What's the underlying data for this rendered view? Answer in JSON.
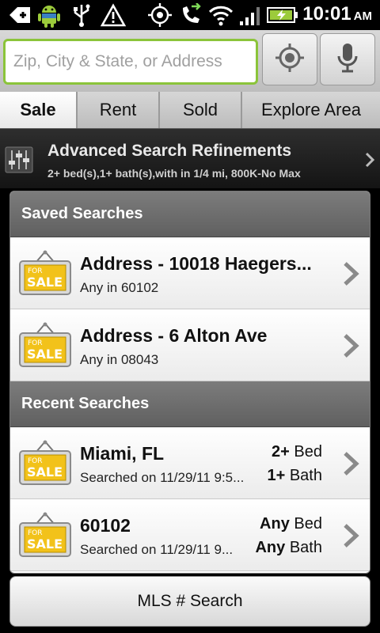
{
  "status_bar": {
    "time": "10:01",
    "ampm": "AM",
    "icons": [
      "back-plus-icon",
      "android-icon",
      "usb-icon",
      "warning-icon",
      "gps-icon",
      "call-forward-icon",
      "wifi-icon",
      "signal-icon",
      "battery-charging-icon"
    ]
  },
  "search": {
    "placeholder": "Zip, City & State, or Address",
    "locate_icon": "locate-icon",
    "voice_icon": "microphone-icon"
  },
  "tabs": [
    {
      "label": "Sale",
      "active": true
    },
    {
      "label": "Rent",
      "active": false
    },
    {
      "label": "Sold",
      "active": false
    },
    {
      "label": "Explore Area",
      "active": false
    }
  ],
  "advanced": {
    "title": "Advanced Search Refinements",
    "subtitle": "2+ bed(s),1+ bath(s),with in 1/4 mi, 800K-No Max"
  },
  "saved": {
    "header": "Saved Searches",
    "items": [
      {
        "title": "Address - 10018 Haegers...",
        "sub": "Any in 60102"
      },
      {
        "title": "Address - 6 Alton Ave",
        "sub": "Any in 08043"
      }
    ]
  },
  "recent": {
    "header": "Recent Searches",
    "items": [
      {
        "title": "Miami, FL",
        "sub": "Searched on 11/29/11 9:5...",
        "bed_value": "2+",
        "bed_label": "Bed",
        "bath_value": "1+",
        "bath_label": "Bath"
      },
      {
        "title": "60102",
        "sub": "Searched on 11/29/11 9...",
        "bed_value": "Any",
        "bed_label": "Bed",
        "bath_value": "Any",
        "bath_label": "Bath"
      }
    ]
  },
  "sign": {
    "small": "FOR",
    "big": "SALE"
  },
  "mls_button": "MLS # Search",
  "colors": {
    "accent_green": "#8bc43a",
    "sign_yellow": "#f2c21a",
    "header_gray": "#6d6d6d"
  }
}
